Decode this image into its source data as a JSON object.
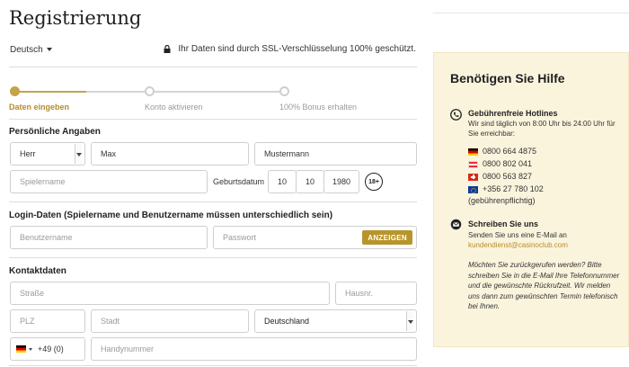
{
  "page": {
    "title": "Registrierung"
  },
  "header": {
    "language": "Deutsch",
    "ssl_notice": "Ihr Daten sind durch SSL-Verschlüsselung 100% geschützt."
  },
  "steps": [
    {
      "label": "Daten eingeben",
      "active": true
    },
    {
      "label": "Konto aktivieren",
      "active": false
    },
    {
      "label": "100% Bonus erhalten",
      "active": false
    }
  ],
  "personal": {
    "heading": "Persönliche Angaben",
    "salutation": "Herr",
    "first_name": "Max",
    "last_name": "Mustermann",
    "username_placeholder": "Spielername",
    "birthdate_label": "Geburtsdatum",
    "birth_day": "10",
    "birth_month": "10",
    "birth_year": "1980",
    "age_badge": "18+"
  },
  "login": {
    "heading": "Login-Daten  (Spielername und Benutzername müssen unterschiedlich sein)",
    "username_placeholder": "Benutzername",
    "password_placeholder": "Passwort",
    "show_button": "ANZEIGEN"
  },
  "contact": {
    "heading": "Kontaktdaten",
    "street_placeholder": "Straße",
    "house_placeholder": "Hausnr.",
    "zip_placeholder": "PLZ",
    "city_placeholder": "Stadt",
    "country": "Deutschland",
    "phone_prefix": "+49 (0)",
    "mobile_placeholder": "Handynummer"
  },
  "help": {
    "title": "Benötigen Sie Hilfe",
    "hotline_heading": "Gebührenfreie Hotlines",
    "hotline_text": "Wir sind täglich von 8:00 Uhr bis 24:00 Uhr für Sie erreichbar:",
    "phones": [
      {
        "flag": "de",
        "number": "0800 664 4875"
      },
      {
        "flag": "at",
        "number": "0800 802 041"
      },
      {
        "flag": "ch",
        "number": "0800 563 827"
      },
      {
        "flag": "eu",
        "number": "+356 27 780 102"
      }
    ],
    "phones_note": "(gebührenpflichtig)",
    "write_heading": "Schreiben Sie uns",
    "write_text": "Senden Sie uns eine E-Mail an",
    "email": "kundendienst@casinoclub.com",
    "callback_note": "Möchten Sie zurückgerufen werden? Bitte schreiben Sie in die E-Mail Ihre Telefonnummer und die gewünschte Rückrufzeit. Wir melden uns dann zum gewünschten Termin telefonisch bei Ihnen."
  },
  "colors": {
    "accent": "#b8952a",
    "help_bg": "#fbf4dd"
  }
}
